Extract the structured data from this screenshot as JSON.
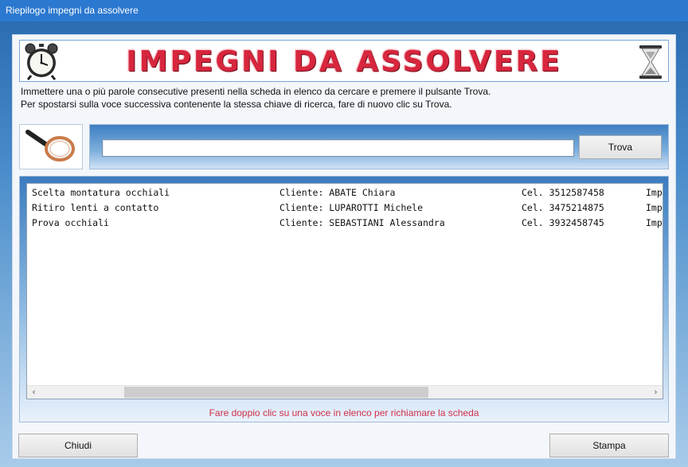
{
  "window": {
    "title": "Riepilogo impegni da assolvere"
  },
  "banner": {
    "title": "IMPEGNI DA ASSOLVERE",
    "left_icon": "alarm-clock-icon",
    "right_icon": "hourglass-icon"
  },
  "instructions": {
    "line1": "Immettere una o più parole consecutive presenti nella scheda in elenco da cercare e premere il pulsante Trova.",
    "line2": "Per spostarsi sulla voce successiva contenente la stessa chiave di ricerca, fare di nuovo clic su Trova."
  },
  "search": {
    "icon": "magnifier-icon",
    "value": "",
    "placeholder": "",
    "button_label": "Trova"
  },
  "list": {
    "rows": [
      {
        "desc": "Scelta montatura occhiali",
        "client": "Cliente: ABATE Chiara",
        "phone": "Cel. 3512587458",
        "extra": "Imp"
      },
      {
        "desc": "Ritiro lenti a contatto",
        "client": "Cliente: LUPAROTTI Michele",
        "phone": "Cel. 3475214875",
        "extra": "Imp"
      },
      {
        "desc": "Prova occhiali",
        "client": "Cliente: SEBASTIANI Alessandra",
        "phone": "Cel. 3932458745",
        "extra": "Imp"
      }
    ],
    "hint": "Fare doppio clic su una voce in elenco per richiamare la scheda"
  },
  "footer": {
    "close_label": "Chiudi",
    "print_label": "Stampa"
  },
  "colors": {
    "title_bar": "#2b78d0",
    "banner_text": "#d7263d",
    "hint_text": "#d0314b"
  }
}
